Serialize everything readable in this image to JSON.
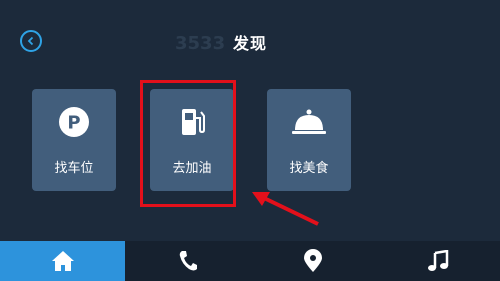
{
  "header": {
    "title": "发现",
    "back_icon": "chevron-left-icon"
  },
  "cards": [
    {
      "label": "找车位",
      "icon": "parking-icon"
    },
    {
      "label": "去加油",
      "icon": "fuel-pump-icon"
    },
    {
      "label": "找美食",
      "icon": "food-cloche-icon"
    }
  ],
  "bottom_nav": [
    {
      "icon": "home-icon",
      "active": true
    },
    {
      "icon": "phone-icon",
      "active": false
    },
    {
      "icon": "map-pin-icon",
      "active": false
    },
    {
      "icon": "music-icon",
      "active": false
    }
  ],
  "colors": {
    "background": "#1c2a3b",
    "card": "#425e7c",
    "accent": "#2d93dc",
    "highlight": "#e3101b"
  }
}
